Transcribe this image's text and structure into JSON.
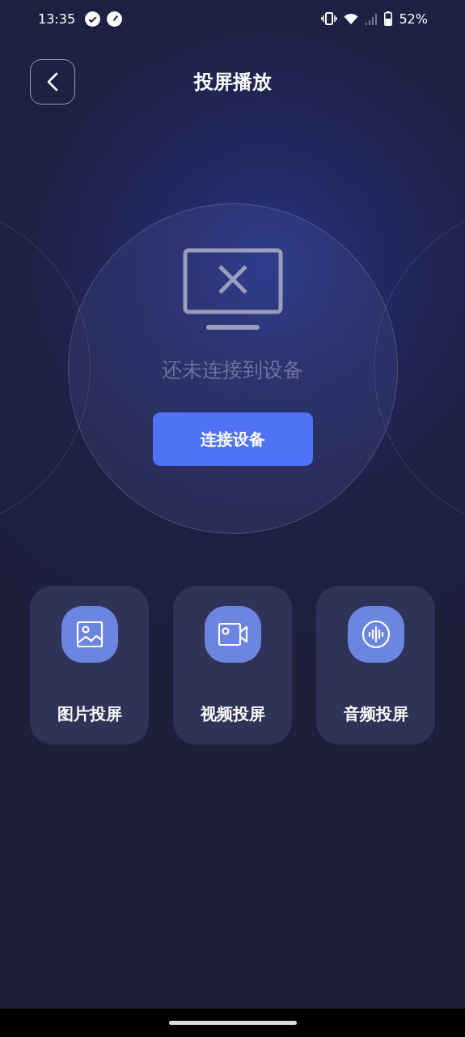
{
  "status_bar": {
    "time": "13:35",
    "battery": "52%"
  },
  "header": {
    "title": "投屏播放"
  },
  "connection": {
    "message": "还未连接到设备",
    "button": "连接设备"
  },
  "features": [
    {
      "kind": "image",
      "label": "图片投屏"
    },
    {
      "kind": "video",
      "label": "视频投屏"
    },
    {
      "kind": "audio",
      "label": "音频投屏"
    }
  ]
}
